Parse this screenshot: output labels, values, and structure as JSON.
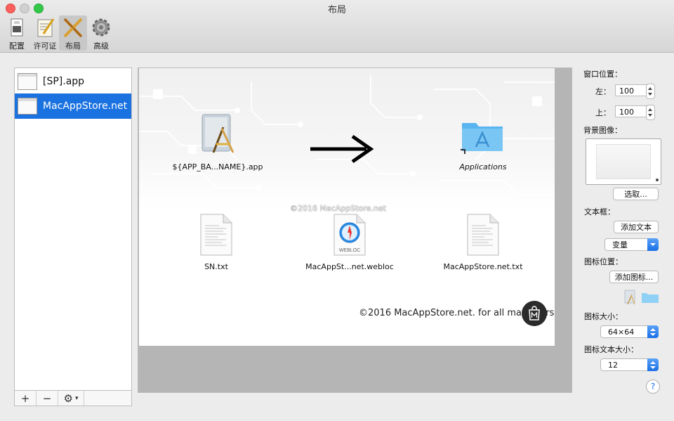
{
  "window": {
    "title": "布局"
  },
  "toolbar": {
    "items": [
      {
        "label": "配置",
        "icon": "config-icon",
        "active": false
      },
      {
        "label": "许可证",
        "icon": "license-icon",
        "active": false
      },
      {
        "label": "布局",
        "icon": "layout-icon",
        "active": true
      },
      {
        "label": "高级",
        "icon": "gear-icon",
        "active": false
      }
    ]
  },
  "sidebar": {
    "items": [
      {
        "label": "[SP].app",
        "selected": false
      },
      {
        "label": "MacAppStore.net",
        "selected": true
      }
    ],
    "footer": {
      "add": "+",
      "remove": "−",
      "action": "⚙"
    }
  },
  "canvas": {
    "icons": [
      {
        "label": "${APP_BA...NAME}.app",
        "icon": "app-icon"
      },
      {
        "label": "Applications",
        "icon": "applications-folder-icon"
      },
      {
        "label": "SN.txt",
        "icon": "text-file-icon"
      },
      {
        "label": "MacAppSt...net.webloc",
        "icon": "webloc-icon"
      },
      {
        "label": "MacAppStore.net.txt",
        "icon": "text-file-icon"
      }
    ],
    "watermark": "©2016 MacAppStore.net",
    "footer_text": "©2016 MacAppStore.net. for all mac users.",
    "webloc_badge": "WEBLOC"
  },
  "settings": {
    "window_position_label": "窗口位置：",
    "left_label": "左：",
    "left_value": "100",
    "top_label": "上：",
    "top_value": "100",
    "background_label": "背景图像：",
    "choose_button": "选取...",
    "textbox_label": "文本框：",
    "add_text_button": "添加文本",
    "variable_popup": "变量",
    "icon_position_label": "图标位置：",
    "add_icon_button": "添加图标...",
    "icon_size_label": "图标大小：",
    "icon_size_value": "64×64",
    "icon_text_size_label": "图标文本大小：",
    "icon_text_size_value": "12",
    "help": "?"
  },
  "colors": {
    "selection": "#1a72e0",
    "accent": "#1a6fe6",
    "folder": "#5ab4ef"
  }
}
